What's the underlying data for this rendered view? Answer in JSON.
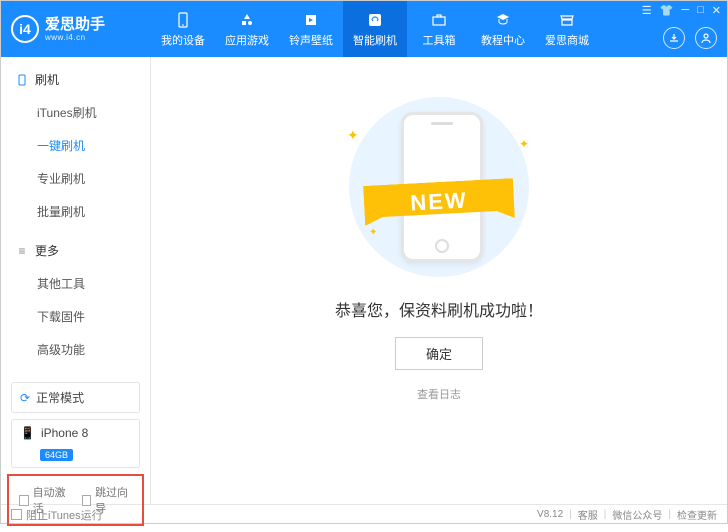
{
  "app": {
    "name": "爱思助手",
    "url": "www.i4.cn",
    "logo": "i4"
  },
  "nav": [
    {
      "label": "我的设备",
      "icon": "device"
    },
    {
      "label": "应用游戏",
      "icon": "apps"
    },
    {
      "label": "铃声壁纸",
      "icon": "ringtone"
    },
    {
      "label": "智能刷机",
      "icon": "flash",
      "active": true
    },
    {
      "label": "工具箱",
      "icon": "toolbox"
    },
    {
      "label": "教程中心",
      "icon": "tutorial"
    },
    {
      "label": "爱思商城",
      "icon": "store"
    }
  ],
  "sidebar": {
    "sections": [
      {
        "title": "刷机",
        "icon": "phone",
        "items": [
          "iTunes刷机",
          "一键刷机",
          "专业刷机",
          "批量刷机"
        ],
        "activeIndex": 1
      },
      {
        "title": "更多",
        "icon": "more",
        "items": [
          "其他工具",
          "下载固件",
          "高级功能"
        ]
      }
    ],
    "mode": "正常模式",
    "device": {
      "name": "iPhone 8",
      "storage": "64GB"
    },
    "checkboxes": [
      "自动激活",
      "跳过向导"
    ]
  },
  "content": {
    "ribbon": "NEW",
    "message": "恭喜您，保资料刷机成功啦！",
    "okLabel": "确定",
    "logLabel": "查看日志"
  },
  "footer": {
    "blockItunes": "阻止iTunes运行",
    "version": "V8.12",
    "links": [
      "客服",
      "微信公众号",
      "检查更新"
    ]
  }
}
